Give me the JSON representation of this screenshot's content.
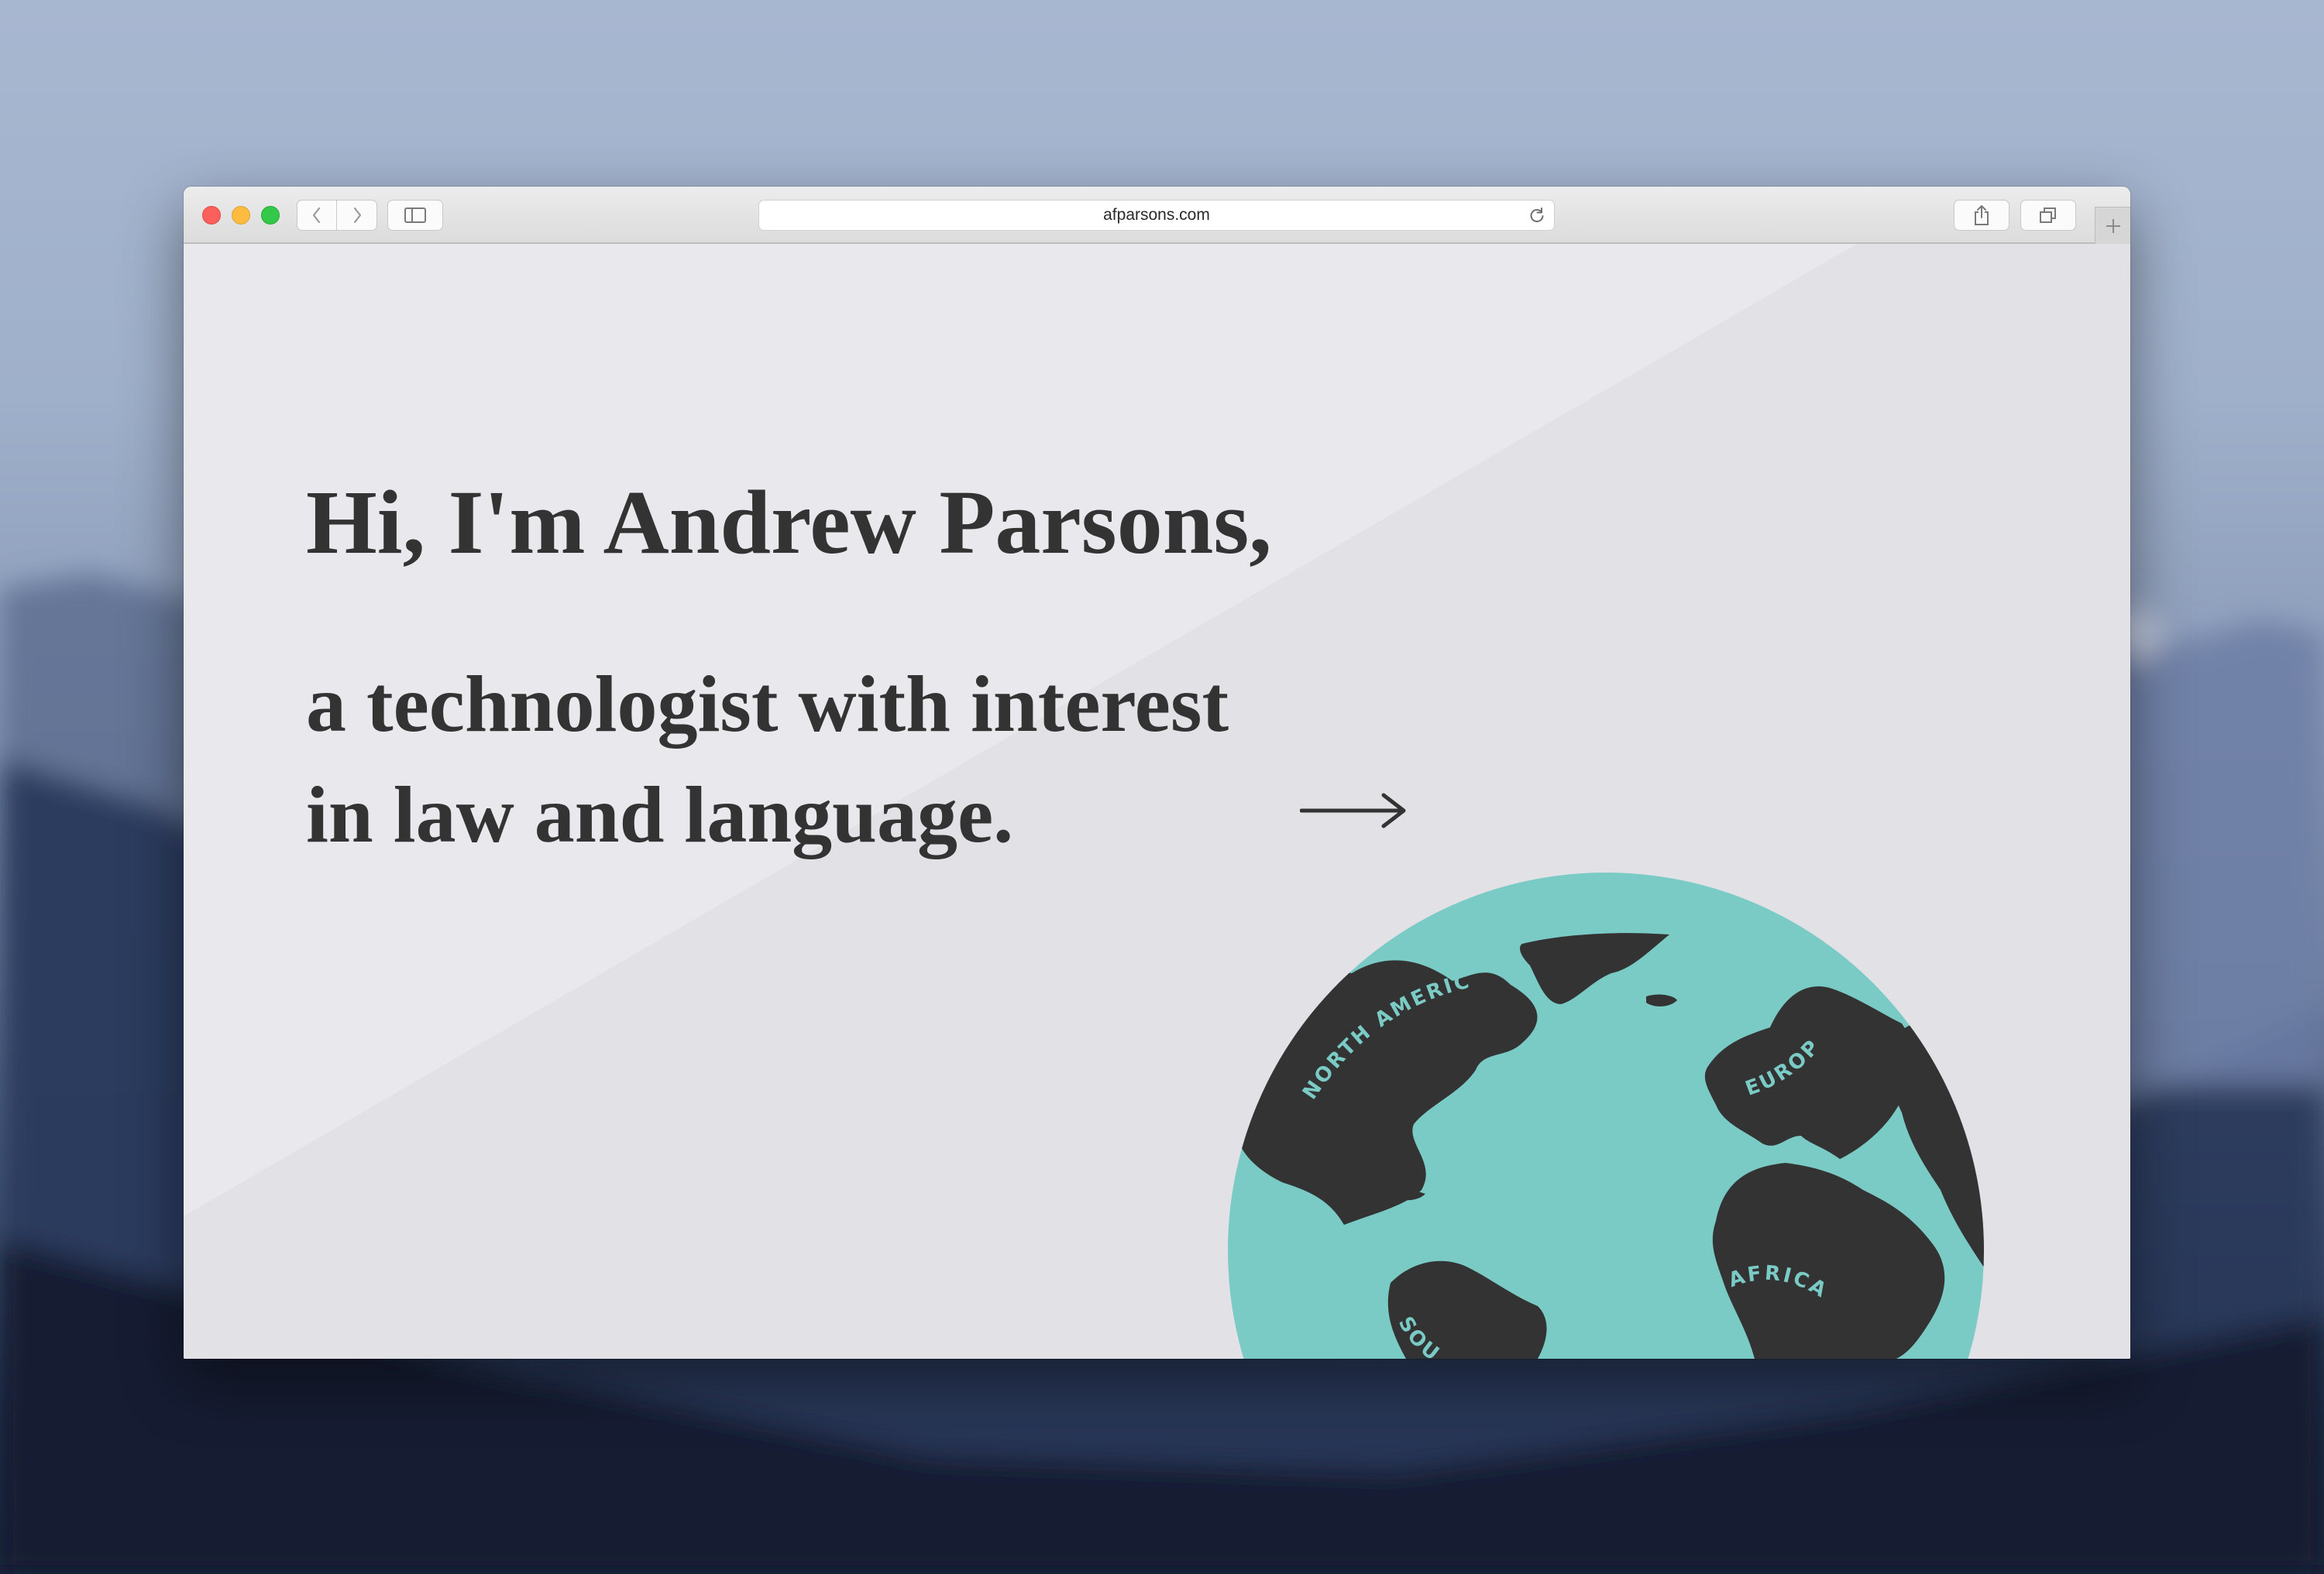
{
  "browser": {
    "url": "afparsons.com",
    "icons": {
      "back": "chevron-left-icon",
      "forward": "chevron-right-icon",
      "sidebar": "sidebar-icon",
      "reload": "reload-icon",
      "share": "share-icon",
      "tabs": "tab-overview-icon",
      "new_tab": "plus-icon"
    }
  },
  "page": {
    "greeting": "Hi, I'm Andrew Parsons,",
    "tagline_line1": "a technologist with interest",
    "tagline_in": "in ",
    "tagline_law": "law",
    "tagline_and": " and ",
    "tagline_language": "language",
    "tagline_period": ".",
    "arrow": "→"
  },
  "globe": {
    "labels": {
      "north_america": "NORTH AMERICA",
      "europe": "EUROPE",
      "africa": "AFRICA",
      "south_america": "SOUTH"
    },
    "ocean_color": "#7acbc6",
    "land_color": "#333333"
  },
  "colors": {
    "highlight": "#f0d75c",
    "text": "#333333",
    "page_background": "#e3e3e8"
  }
}
